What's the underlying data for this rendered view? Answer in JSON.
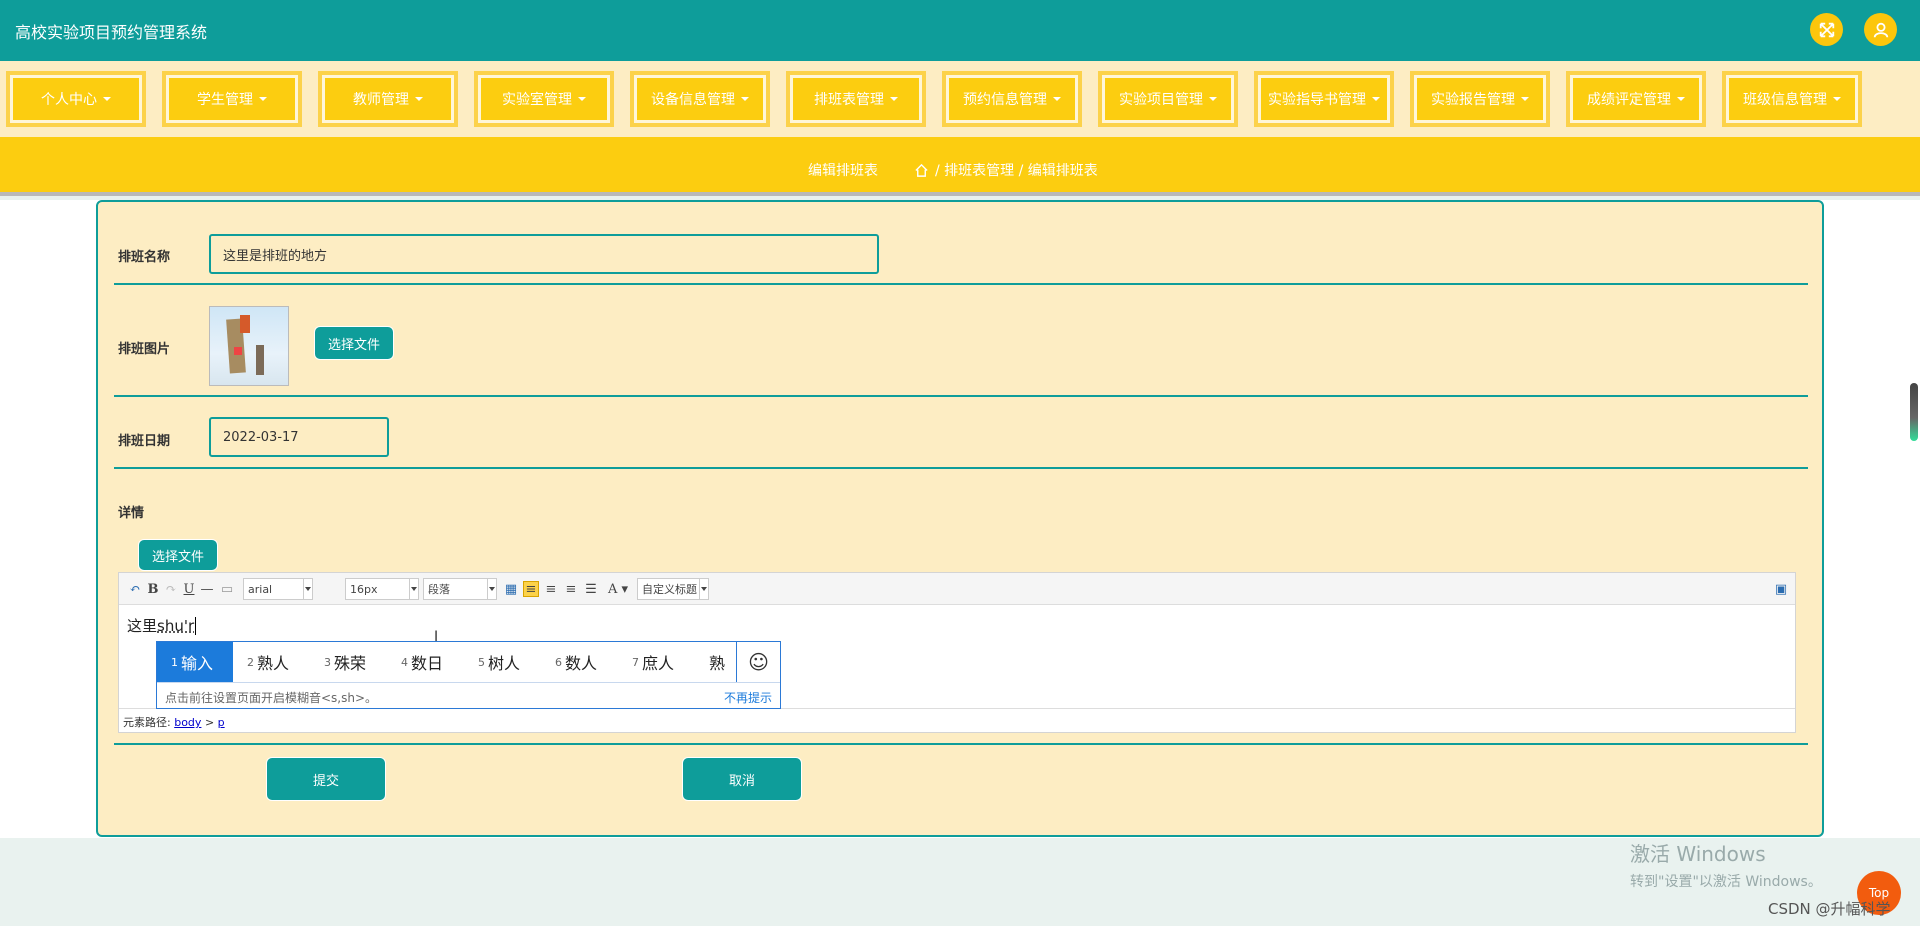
{
  "header": {
    "title": "高校实验项目预约管理系统",
    "fullscreen_icon": "fullscreen-icon",
    "user_icon": "user-icon"
  },
  "nav": {
    "items": [
      {
        "label": "个人中心"
      },
      {
        "label": "学生管理"
      },
      {
        "label": "教师管理"
      },
      {
        "label": "实验室管理"
      },
      {
        "label": "设备信息管理"
      },
      {
        "label": "排班表管理"
      },
      {
        "label": "预约信息管理"
      },
      {
        "label": "实验项目管理"
      },
      {
        "label": "实验指导书管理"
      },
      {
        "label": "实验报告管理"
      },
      {
        "label": "成绩评定管理"
      },
      {
        "label": "班级信息管理"
      }
    ]
  },
  "breadcrumb": {
    "page_title": "编辑排班表",
    "home_icon": "home-icon",
    "path": "/ 排班表管理 / 编辑排班表"
  },
  "form": {
    "name_label": "排班名称",
    "name_value": "这里是排班的地方",
    "image_label": "排班图片",
    "choose_file": "选择文件",
    "date_label": "排班日期",
    "date_value": "2022-03-17",
    "detail_label": "详情",
    "detail_choose_file": "选择文件",
    "submit": "提交",
    "cancel": "取消"
  },
  "editor": {
    "font_family": "arial",
    "font_size": "16px",
    "paragraph": "段落",
    "custom_title": "自定义标题",
    "content_prefix": "这里",
    "content_pinyin": "shu'r",
    "element_path_label": "元素路径:",
    "path_body": "body",
    "path_sep": ">",
    "path_p": "p"
  },
  "ime": {
    "candidates": [
      {
        "n": "1",
        "text": "输入"
      },
      {
        "n": "2",
        "text": "熟人"
      },
      {
        "n": "3",
        "text": "殊荣"
      },
      {
        "n": "4",
        "text": "数日"
      },
      {
        "n": "5",
        "text": "树人"
      },
      {
        "n": "6",
        "text": "数人"
      },
      {
        "n": "7",
        "text": "庶人"
      },
      {
        "n": "",
        "text": "熟"
      }
    ],
    "hint": "点击前往设置页面开启模糊音<s,sh>。",
    "dismiss": "不再提示",
    "emoji": "☺"
  },
  "watermark": {
    "activate_title": "激活 Windows",
    "activate_sub": "转到\"设置\"以激活 Windows。",
    "top_label": "Top",
    "csdn": "CSDN @升幅科学"
  },
  "colors": {
    "primary": "#0e9d9a",
    "accent": "#fccd10",
    "panel": "#fdedc3"
  }
}
